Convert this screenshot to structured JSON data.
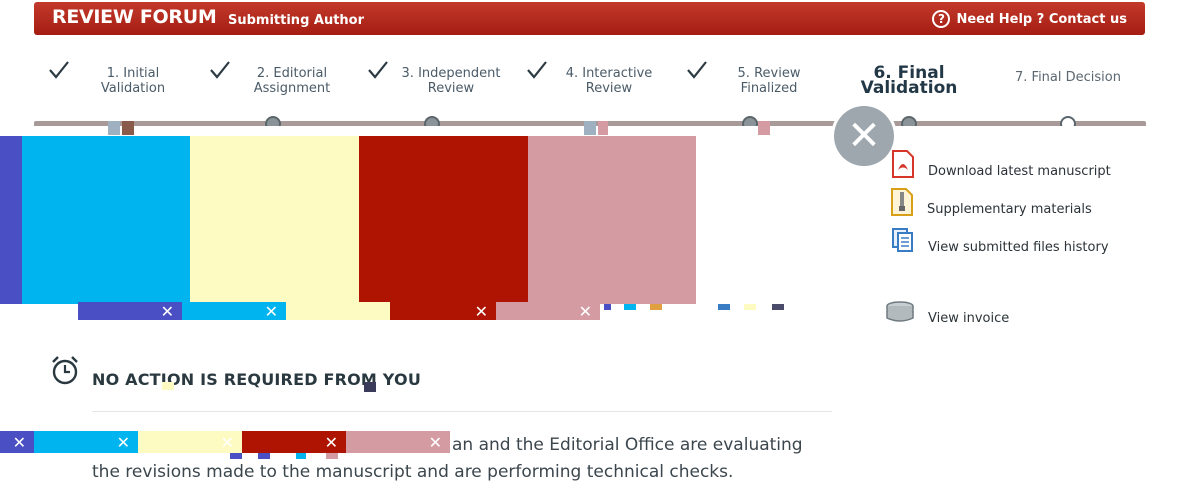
{
  "header": {
    "brand": "REVIEW FORUM",
    "role": "Submitting Author",
    "help": "Need Help ? Contact us",
    "help_icon": "question-circle-icon"
  },
  "steps": [
    {
      "label_line1": "1. Initial",
      "label_line2": "Validation",
      "status": "done"
    },
    {
      "label_line1": "2. Editorial",
      "label_line2": "Assignment",
      "status": "done"
    },
    {
      "label_line1": "3. Independent",
      "label_line2": "Review",
      "status": "done"
    },
    {
      "label_line1": "4. Interactive",
      "label_line2": "Review",
      "status": "done"
    },
    {
      "label_line1": "5. Review",
      "label_line2": "Finalized",
      "status": "done"
    },
    {
      "label_line1": "6. Final Validation",
      "label_line2": "",
      "status": "current"
    },
    {
      "label_line1": "7. Final Decision",
      "label_line2": "",
      "status": "future"
    }
  ],
  "side_links": {
    "download": "Download latest manuscript",
    "supplementary": "Supplementary materials",
    "history": "View submitted files history",
    "invoice": "View invoice"
  },
  "status": {
    "title": "NO ACTION IS REQUIRED FROM YOU",
    "line1_visible": "an and the Editorial Office are evaluating",
    "line2": "the revisions made to the manuscript and are performing technical checks."
  },
  "overlay": {
    "close_glyph": "✕",
    "tile_glyph": "✕",
    "colors": [
      "#4a4fc4",
      "#00b4f0",
      "#fdfbc1",
      "#ae1401",
      "#d49ca2"
    ]
  }
}
